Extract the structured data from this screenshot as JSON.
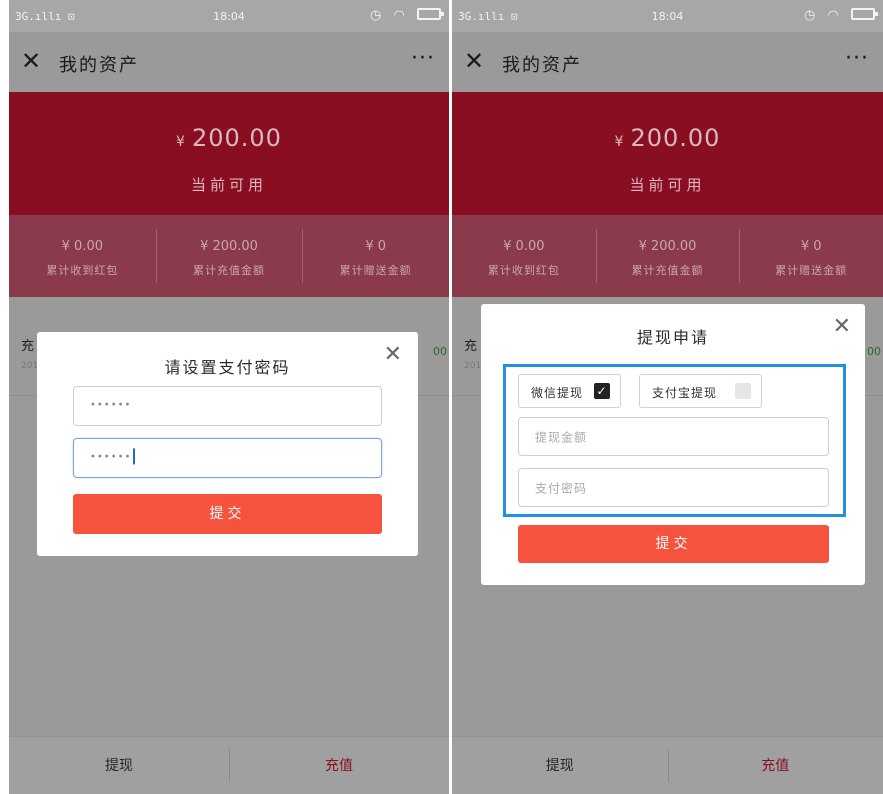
{
  "status_bar": {
    "signal": "3G.ıllı ⊡",
    "time": "18:04"
  },
  "nav": {
    "close_glyph": "✕",
    "title": "我的资产",
    "more_glyph": "···"
  },
  "hero": {
    "currency": "¥",
    "amount": "200.00",
    "label": "当前可用"
  },
  "stats": [
    {
      "value": "¥ 0.00",
      "label": "累计收到红包"
    },
    {
      "value": "¥ 200.00",
      "label": "累计充值金额"
    },
    {
      "value": "¥ 0",
      "label": "累计赠送金额"
    }
  ],
  "list_peek": {
    "left": "充",
    "sub": "201",
    "right": "00"
  },
  "tabs": {
    "withdraw": "提现",
    "recharge": "充值"
  },
  "password_dialog": {
    "title": "请设置支付密码",
    "close_glyph": "✕",
    "field1_value": "••••••",
    "field2_value": "••••••",
    "submit": "提交"
  },
  "withdraw_dialog": {
    "title": "提现申请",
    "close_glyph": "✕",
    "option_wechat": "微信提现",
    "option_wechat_checked": true,
    "option_alipay": "支付宝提现",
    "option_alipay_checked": false,
    "amount_placeholder": "提现金额",
    "password_placeholder": "支付密码",
    "submit": "提交"
  },
  "colors": {
    "brand_red": "#8a0e22",
    "submit_orange": "#f5533d",
    "highlight_blue": "#1e90e6"
  }
}
